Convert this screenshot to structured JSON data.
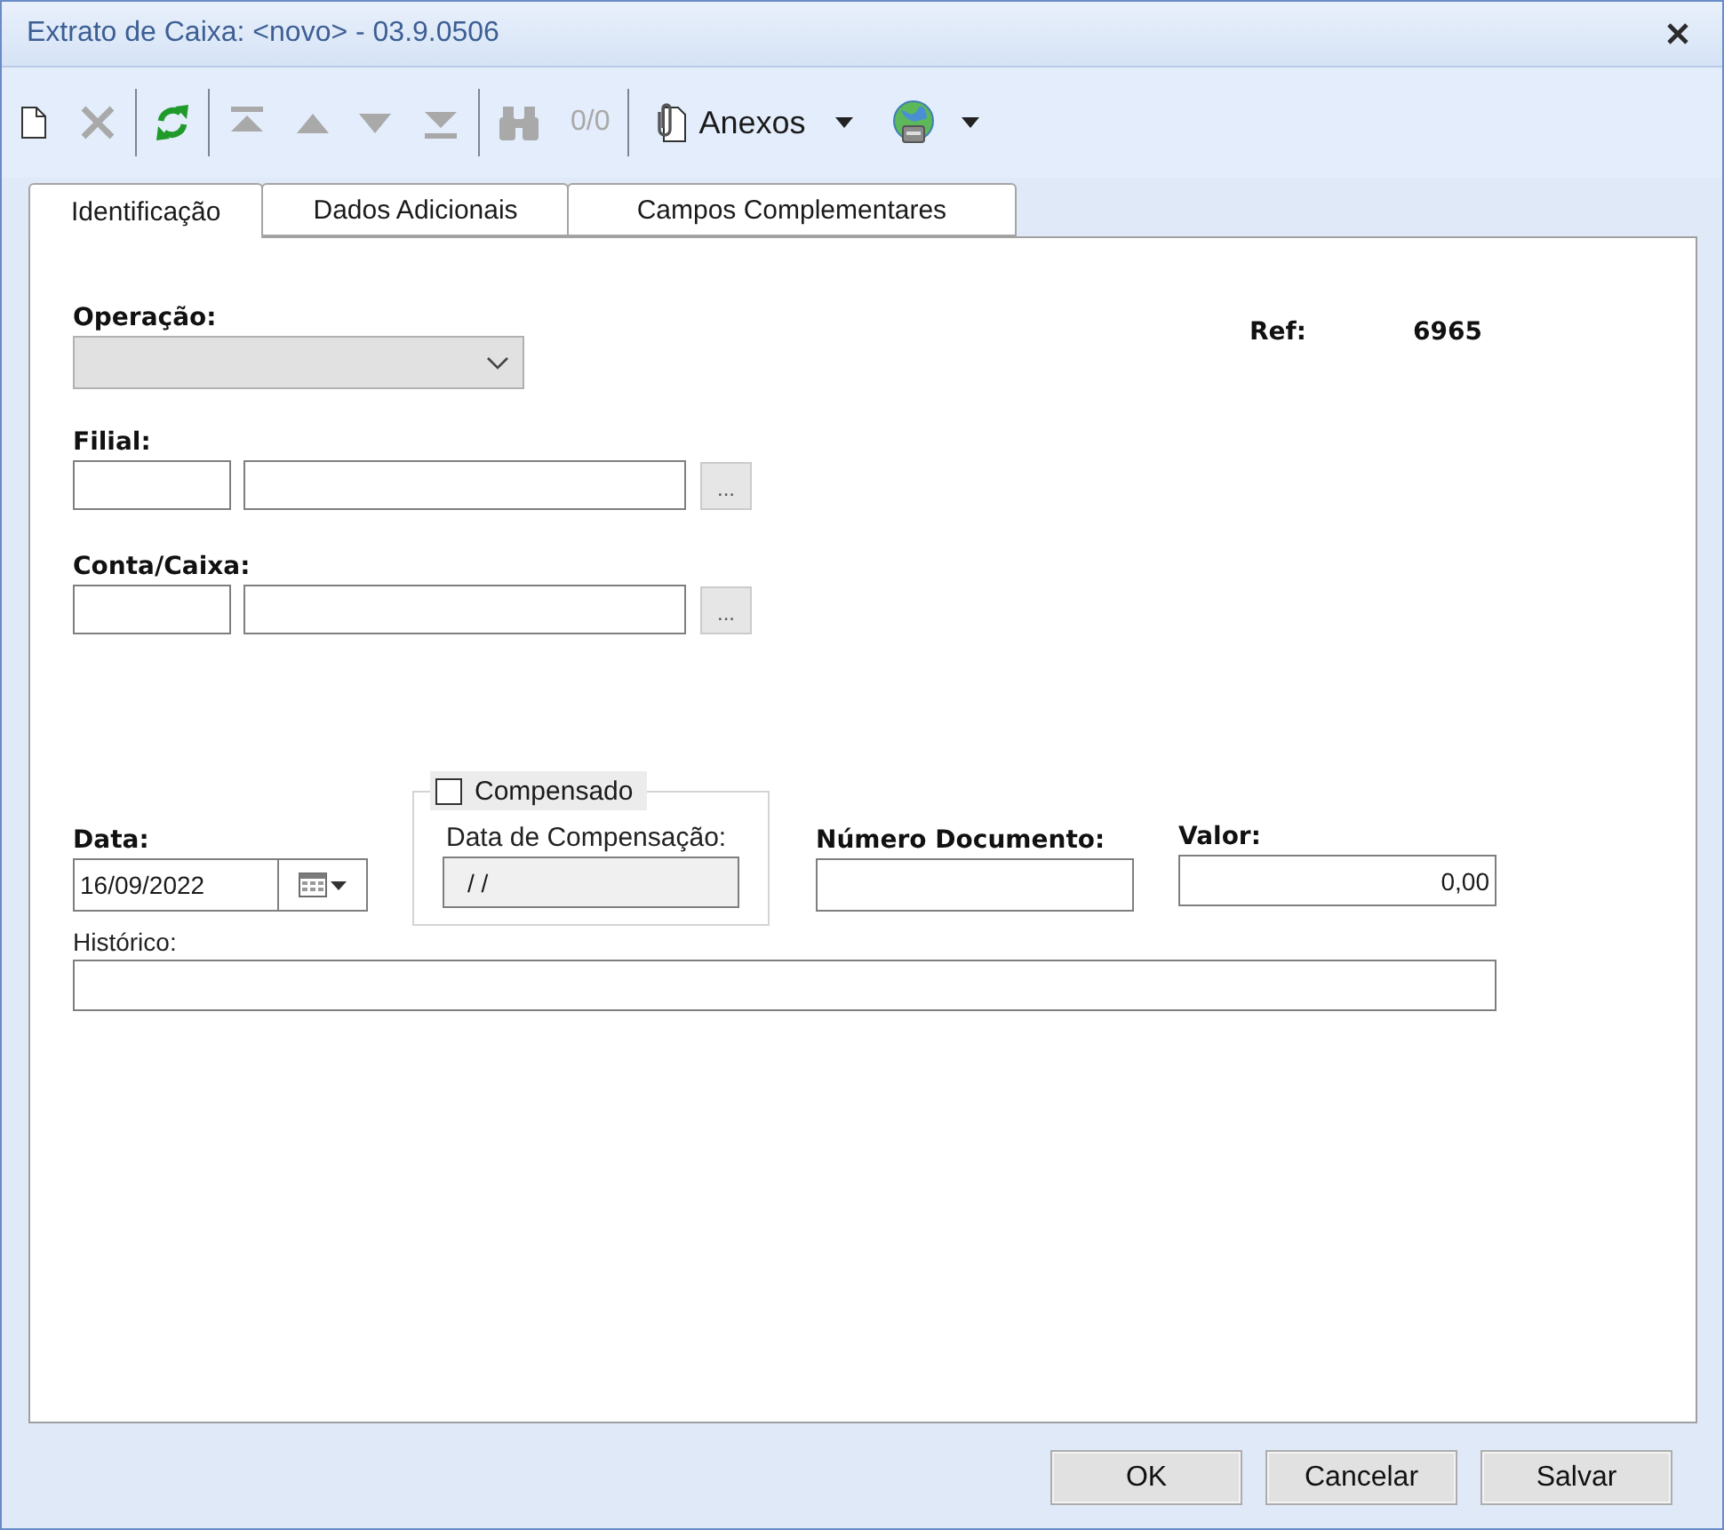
{
  "window": {
    "title": "Extrato de Caixa: <novo> - 03.9.0506"
  },
  "toolbar": {
    "groups": [
      {
        "items": [
          {
            "kind": "new",
            "disabled": false
          },
          {
            "kind": "delete",
            "disabled": true
          }
        ]
      },
      {
        "items": [
          {
            "kind": "refresh",
            "disabled": false
          }
        ]
      },
      {
        "items": [
          {
            "kind": "first",
            "disabled": true
          },
          {
            "kind": "previous",
            "disabled": true
          },
          {
            "kind": "next",
            "disabled": true
          },
          {
            "kind": "last",
            "disabled": true
          }
        ]
      },
      {
        "items": [
          {
            "kind": "find",
            "disabled": true
          },
          {
            "kind": "counter",
            "text": "0/0",
            "disabled": true
          }
        ]
      },
      {
        "items": [
          {
            "kind": "menu",
            "label": "Anexos",
            "disabled": false
          },
          {
            "kind": "globe_menu",
            "disabled": false
          }
        ]
      }
    ]
  },
  "tabs": [
    {
      "label": "Identificação",
      "selected": true
    },
    {
      "label": "Dados Adicionais",
      "selected": false
    },
    {
      "label": "Campos Complementares",
      "selected": false
    }
  ],
  "form": {
    "operacao": {
      "label": "Operação:",
      "disabled": true
    },
    "ref": {
      "label": "Ref:",
      "value": "6965"
    },
    "filial": {
      "label": "Filial:",
      "browse": "..."
    },
    "conta_caixa": {
      "label": "Conta/Caixa:",
      "browse": "..."
    },
    "data": {
      "label": "Data:",
      "value": "16/09/2022"
    },
    "compensado": {
      "label": "Compensado",
      "checked": false,
      "date_label": "Data de Compensação:",
      "date_value": "/ /",
      "date_disabled": true
    },
    "numero_documento": {
      "label": "Número Documento:"
    },
    "valor": {
      "label": "Valor:",
      "value": "0,00"
    },
    "historico": {
      "label": "Histórico:"
    }
  },
  "buttons": [
    {
      "label": "OK"
    },
    {
      "label": "Cancelar"
    },
    {
      "label": "Salvar"
    }
  ]
}
